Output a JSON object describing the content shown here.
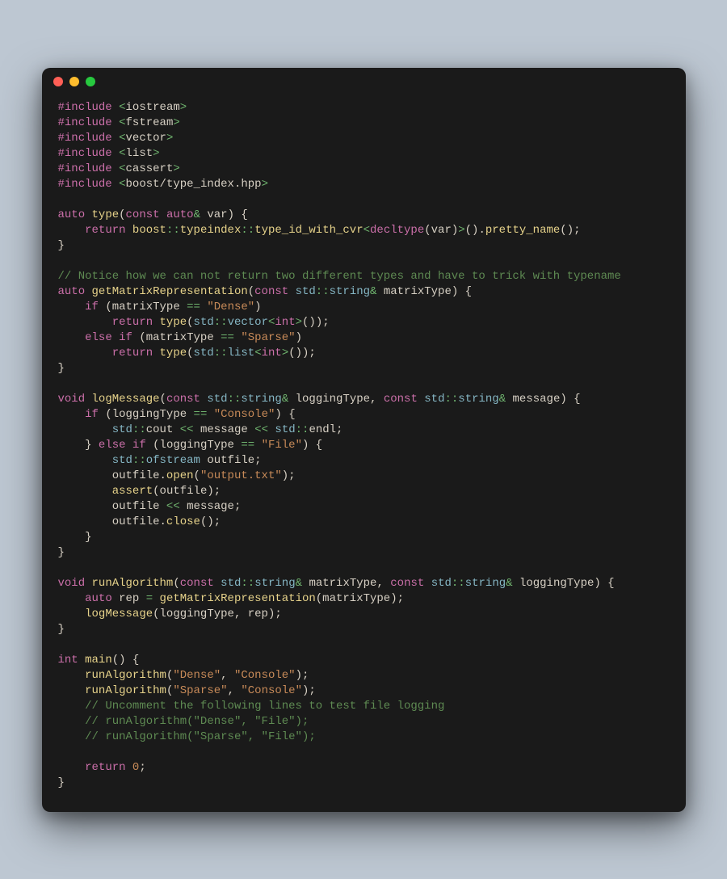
{
  "window": {
    "dots": [
      "red",
      "yellow",
      "green"
    ]
  },
  "code": {
    "lines": [
      [
        [
          "pp",
          "#include "
        ],
        [
          "op",
          "<"
        ],
        [
          "inc",
          "iostream"
        ],
        [
          "op",
          ">"
        ]
      ],
      [
        [
          "pp",
          "#include "
        ],
        [
          "op",
          "<"
        ],
        [
          "inc",
          "fstream"
        ],
        [
          "op",
          ">"
        ]
      ],
      [
        [
          "pp",
          "#include "
        ],
        [
          "op",
          "<"
        ],
        [
          "inc",
          "vector"
        ],
        [
          "op",
          ">"
        ]
      ],
      [
        [
          "pp",
          "#include "
        ],
        [
          "op",
          "<"
        ],
        [
          "inc",
          "list"
        ],
        [
          "op",
          ">"
        ]
      ],
      [
        [
          "pp",
          "#include "
        ],
        [
          "op",
          "<"
        ],
        [
          "inc",
          "cassert"
        ],
        [
          "op",
          ">"
        ]
      ],
      [
        [
          "pp",
          "#include "
        ],
        [
          "op",
          "<"
        ],
        [
          "inc",
          "boost/type_index.hpp"
        ],
        [
          "op",
          ">"
        ]
      ],
      [],
      [
        [
          "kw",
          "auto "
        ],
        [
          "fn",
          "type"
        ],
        [
          "id",
          "("
        ],
        [
          "kw",
          "const "
        ],
        [
          "kw",
          "auto"
        ],
        [
          "op",
          "& "
        ],
        [
          "id",
          "var) {"
        ]
      ],
      [
        [
          "id",
          "    "
        ],
        [
          "kw",
          "return "
        ],
        [
          "ns",
          "boost"
        ],
        [
          "op",
          "::"
        ],
        [
          "ns",
          "typeindex"
        ],
        [
          "op",
          "::"
        ],
        [
          "fn",
          "type_id_with_cvr"
        ],
        [
          "op",
          "<"
        ],
        [
          "kw",
          "decltype"
        ],
        [
          "id",
          "(var)"
        ],
        [
          "op",
          ">"
        ],
        [
          "id",
          "()."
        ],
        [
          "fn",
          "pretty_name"
        ],
        [
          "id",
          "();"
        ]
      ],
      [
        [
          "id",
          "}"
        ]
      ],
      [],
      [
        [
          "cmt",
          "// Notice how we can not return two different types and have to trick with typename"
        ]
      ],
      [
        [
          "kw",
          "auto "
        ],
        [
          "fn",
          "getMatrixRepresentation"
        ],
        [
          "id",
          "("
        ],
        [
          "kw",
          "const "
        ],
        [
          "type",
          "std"
        ],
        [
          "op",
          "::"
        ],
        [
          "type",
          "string"
        ],
        [
          "op",
          "& "
        ],
        [
          "id",
          "matrixType) {"
        ]
      ],
      [
        [
          "id",
          "    "
        ],
        [
          "kw",
          "if"
        ],
        [
          "id",
          " (matrixType "
        ],
        [
          "op",
          "== "
        ],
        [
          "str",
          "\"Dense\""
        ],
        [
          "id",
          ")"
        ]
      ],
      [
        [
          "id",
          "        "
        ],
        [
          "kw",
          "return "
        ],
        [
          "fn",
          "type"
        ],
        [
          "id",
          "("
        ],
        [
          "type",
          "std"
        ],
        [
          "op",
          "::"
        ],
        [
          "type",
          "vector"
        ],
        [
          "op",
          "<"
        ],
        [
          "kw",
          "int"
        ],
        [
          "op",
          ">"
        ],
        [
          "id",
          "());"
        ]
      ],
      [
        [
          "id",
          "    "
        ],
        [
          "kw",
          "else if"
        ],
        [
          "id",
          " (matrixType "
        ],
        [
          "op",
          "== "
        ],
        [
          "str",
          "\"Sparse\""
        ],
        [
          "id",
          ")"
        ]
      ],
      [
        [
          "id",
          "        "
        ],
        [
          "kw",
          "return "
        ],
        [
          "fn",
          "type"
        ],
        [
          "id",
          "("
        ],
        [
          "type",
          "std"
        ],
        [
          "op",
          "::"
        ],
        [
          "type",
          "list"
        ],
        [
          "op",
          "<"
        ],
        [
          "kw",
          "int"
        ],
        [
          "op",
          ">"
        ],
        [
          "id",
          "());"
        ]
      ],
      [
        [
          "id",
          "}"
        ]
      ],
      [],
      [
        [
          "kw",
          "void "
        ],
        [
          "fn",
          "logMessage"
        ],
        [
          "id",
          "("
        ],
        [
          "kw",
          "const "
        ],
        [
          "type",
          "std"
        ],
        [
          "op",
          "::"
        ],
        [
          "type",
          "string"
        ],
        [
          "op",
          "& "
        ],
        [
          "id",
          "loggingType, "
        ],
        [
          "kw",
          "const "
        ],
        [
          "type",
          "std"
        ],
        [
          "op",
          "::"
        ],
        [
          "type",
          "string"
        ],
        [
          "op",
          "& "
        ],
        [
          "id",
          "message) {"
        ]
      ],
      [
        [
          "id",
          "    "
        ],
        [
          "kw",
          "if"
        ],
        [
          "id",
          " (loggingType "
        ],
        [
          "op",
          "== "
        ],
        [
          "str",
          "\"Console\""
        ],
        [
          "id",
          ") {"
        ]
      ],
      [
        [
          "id",
          "        "
        ],
        [
          "type",
          "std"
        ],
        [
          "op",
          "::"
        ],
        [
          "id",
          "cout "
        ],
        [
          "op",
          "<< "
        ],
        [
          "id",
          "message "
        ],
        [
          "op",
          "<< "
        ],
        [
          "type",
          "std"
        ],
        [
          "op",
          "::"
        ],
        [
          "id",
          "endl;"
        ]
      ],
      [
        [
          "id",
          "    } "
        ],
        [
          "kw",
          "else if"
        ],
        [
          "id",
          " (loggingType "
        ],
        [
          "op",
          "== "
        ],
        [
          "str",
          "\"File\""
        ],
        [
          "id",
          ") {"
        ]
      ],
      [
        [
          "id",
          "        "
        ],
        [
          "type",
          "std"
        ],
        [
          "op",
          "::"
        ],
        [
          "type",
          "ofstream"
        ],
        [
          "id",
          " outfile;"
        ]
      ],
      [
        [
          "id",
          "        outfile."
        ],
        [
          "fn",
          "open"
        ],
        [
          "id",
          "("
        ],
        [
          "str",
          "\"output.txt\""
        ],
        [
          "id",
          ");"
        ]
      ],
      [
        [
          "id",
          "        "
        ],
        [
          "fn",
          "assert"
        ],
        [
          "id",
          "(outfile);"
        ]
      ],
      [
        [
          "id",
          "        outfile "
        ],
        [
          "op",
          "<< "
        ],
        [
          "id",
          "message;"
        ]
      ],
      [
        [
          "id",
          "        outfile."
        ],
        [
          "fn",
          "close"
        ],
        [
          "id",
          "();"
        ]
      ],
      [
        [
          "id",
          "    }"
        ]
      ],
      [
        [
          "id",
          "}"
        ]
      ],
      [],
      [
        [
          "kw",
          "void "
        ],
        [
          "fn",
          "runAlgorithm"
        ],
        [
          "id",
          "("
        ],
        [
          "kw",
          "const "
        ],
        [
          "type",
          "std"
        ],
        [
          "op",
          "::"
        ],
        [
          "type",
          "string"
        ],
        [
          "op",
          "& "
        ],
        [
          "id",
          "matrixType, "
        ],
        [
          "kw",
          "const "
        ],
        [
          "type",
          "std"
        ],
        [
          "op",
          "::"
        ],
        [
          "type",
          "string"
        ],
        [
          "op",
          "& "
        ],
        [
          "id",
          "loggingType) {"
        ]
      ],
      [
        [
          "id",
          "    "
        ],
        [
          "kw",
          "auto"
        ],
        [
          "id",
          " rep "
        ],
        [
          "op",
          "= "
        ],
        [
          "fn",
          "getMatrixRepresentation"
        ],
        [
          "id",
          "(matrixType);"
        ]
      ],
      [
        [
          "id",
          "    "
        ],
        [
          "fn",
          "logMessage"
        ],
        [
          "id",
          "(loggingType, rep);"
        ]
      ],
      [
        [
          "id",
          "}"
        ]
      ],
      [],
      [
        [
          "kw",
          "int "
        ],
        [
          "fn",
          "main"
        ],
        [
          "id",
          "() {"
        ]
      ],
      [
        [
          "id",
          "    "
        ],
        [
          "fn",
          "runAlgorithm"
        ],
        [
          "id",
          "("
        ],
        [
          "str",
          "\"Dense\""
        ],
        [
          "id",
          ", "
        ],
        [
          "str",
          "\"Console\""
        ],
        [
          "id",
          ");"
        ]
      ],
      [
        [
          "id",
          "    "
        ],
        [
          "fn",
          "runAlgorithm"
        ],
        [
          "id",
          "("
        ],
        [
          "str",
          "\"Sparse\""
        ],
        [
          "id",
          ", "
        ],
        [
          "str",
          "\"Console\""
        ],
        [
          "id",
          ");"
        ]
      ],
      [
        [
          "id",
          "    "
        ],
        [
          "cmt",
          "// Uncomment the following lines to test file logging"
        ]
      ],
      [
        [
          "id",
          "    "
        ],
        [
          "cmt",
          "// runAlgorithm(\"Dense\", \"File\");"
        ]
      ],
      [
        [
          "id",
          "    "
        ],
        [
          "cmt",
          "// runAlgorithm(\"Sparse\", \"File\");"
        ]
      ],
      [],
      [
        [
          "id",
          "    "
        ],
        [
          "kw",
          "return "
        ],
        [
          "num",
          "0"
        ],
        [
          "id",
          ";"
        ]
      ],
      [
        [
          "id",
          "}"
        ]
      ]
    ]
  }
}
